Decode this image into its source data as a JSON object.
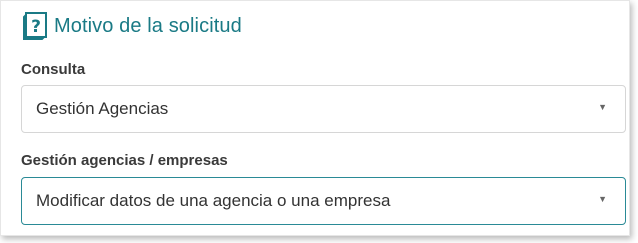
{
  "section": {
    "title": "Motivo de la solicitud",
    "icon": "help-book-icon",
    "accent_color": "#1a7a85"
  },
  "fields": [
    {
      "label": "Consulta",
      "selected": "Gestión Agencias"
    },
    {
      "label": "Gestión agencias / empresas",
      "selected": "Modificar datos de una agencia o una empresa"
    }
  ],
  "caret_glyph": "▼"
}
